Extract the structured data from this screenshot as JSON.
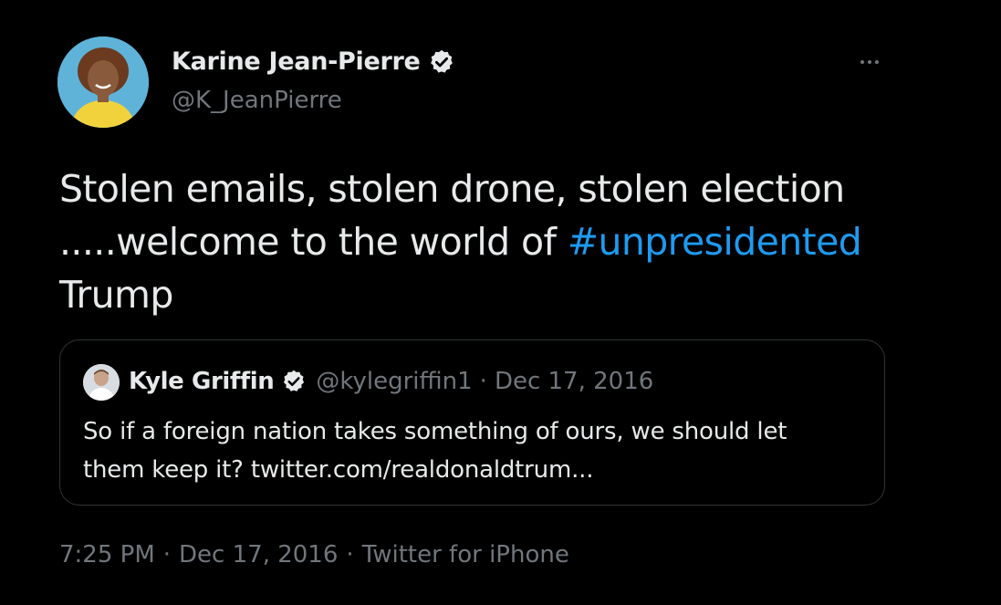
{
  "author": {
    "display_name": "Karine Jean-Pierre",
    "handle": "@K_JeanPierre",
    "verified_icon": "verified-badge-icon",
    "avatar_bg": "#5fb3d9"
  },
  "more_menu": {
    "icon": "more-horizontal-icon"
  },
  "tweet": {
    "line1": "Stolen emails, stolen drone, stolen election",
    "line2_prefix": ".....welcome to the world of ",
    "hashtag": "#unpresidented",
    "line3": "Trump"
  },
  "quoted_tweet": {
    "display_name": "Kyle Griffin",
    "handle": "@kylegriffin1",
    "separator": "·",
    "date": "Dec 17, 2016",
    "text_line1": "So if a foreign nation takes something of ours, we should let",
    "text_line2": "them keep it? twitter.com/realdonaldtrum..."
  },
  "meta": {
    "time": "7:25 PM",
    "separator": "·",
    "date": "Dec 17, 2016",
    "source": "Twitter for iPhone"
  },
  "colors": {
    "background": "#000000",
    "text_primary": "#e7e9ea",
    "text_secondary": "#71767b",
    "link": "#1d9bf0",
    "border": "#2f3336"
  }
}
